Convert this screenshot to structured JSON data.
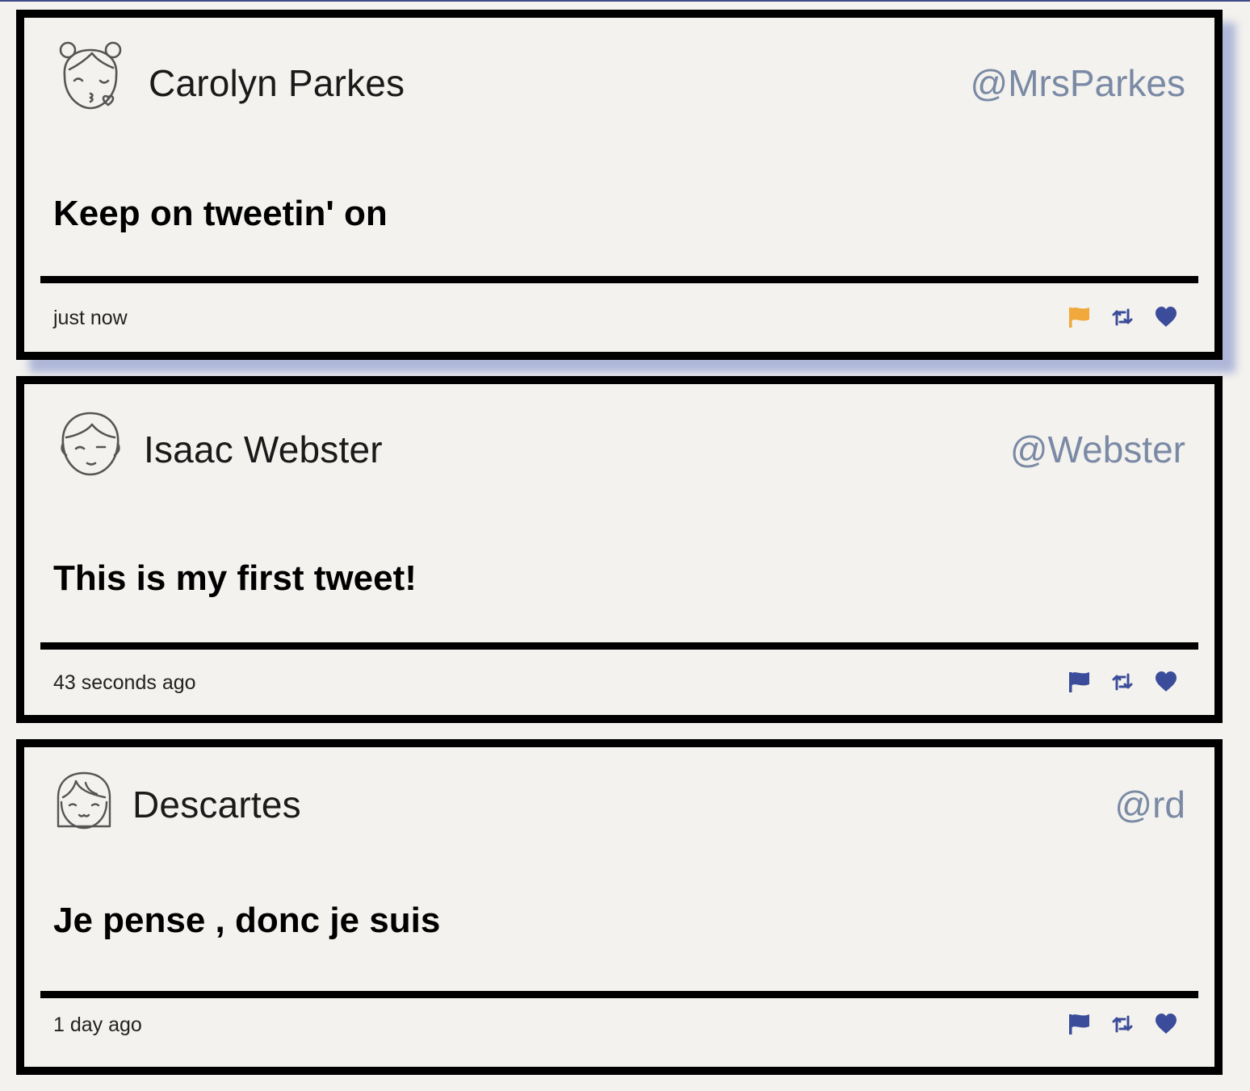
{
  "colors": {
    "background": "#f4f2ee",
    "handle": "#7a8aa5",
    "action_blue": "#3b4c9a",
    "flag_flagged": "#f0a93a",
    "border": "#000000"
  },
  "tweets": [
    {
      "avatar_icon": "girl-buns-kiss-avatar-icon",
      "name": "Carolyn Parkes",
      "handle": "@MrsParkes",
      "text": "Keep on tweetin' on",
      "time": "just now",
      "flagged": true,
      "actions": [
        "flag-icon",
        "retweet-icon",
        "heart-icon"
      ]
    },
    {
      "avatar_icon": "boy-avatar-icon",
      "name": "Isaac Webster",
      "handle": "@Webster",
      "text": "This is my first tweet!",
      "time": "43 seconds ago",
      "flagged": false,
      "actions": [
        "flag-icon",
        "retweet-icon",
        "heart-icon"
      ]
    },
    {
      "avatar_icon": "girl-bangs-avatar-icon",
      "name": "Descartes",
      "handle": "@rd",
      "text": "Je pense , donc je suis",
      "time": "1 day ago",
      "flagged": false,
      "actions": [
        "flag-icon",
        "retweet-icon",
        "heart-icon"
      ]
    }
  ]
}
